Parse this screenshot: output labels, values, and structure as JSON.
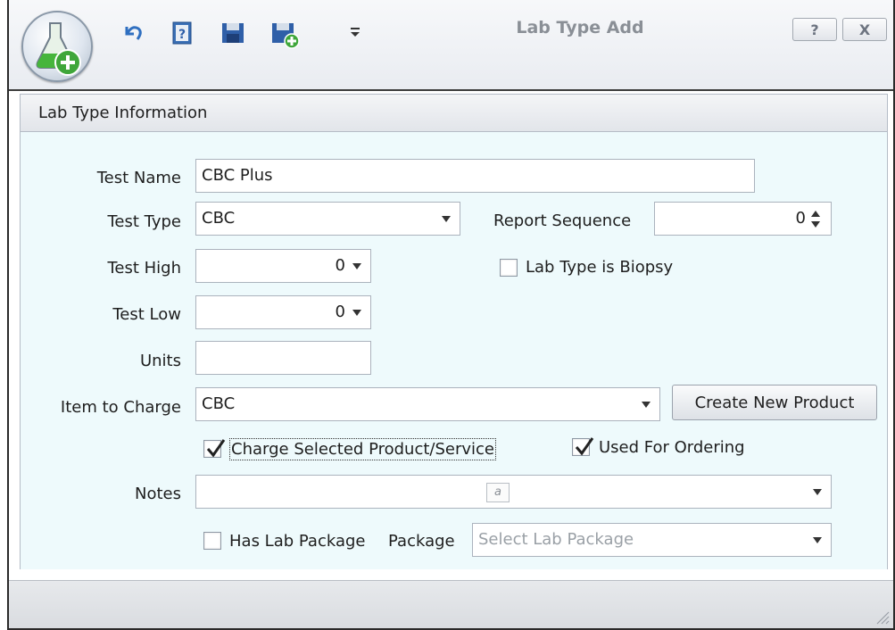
{
  "window": {
    "title": "Lab Type Add",
    "help_button": "?",
    "close_button": "X"
  },
  "quick_access": {
    "icons": [
      "undo-icon",
      "help-icon",
      "save-icon",
      "save-and-new-icon",
      "customize-dropdown-icon"
    ]
  },
  "group": {
    "header": "Lab Type Information"
  },
  "form": {
    "test_name": {
      "label": "Test Name",
      "value": "CBC Plus"
    },
    "test_type": {
      "label": "Test Type",
      "value": "CBC"
    },
    "report_sequence": {
      "label": "Report Sequence",
      "value": "0"
    },
    "test_high": {
      "label": "Test High",
      "value": "0"
    },
    "test_low": {
      "label": "Test Low",
      "value": "0"
    },
    "lab_type_is_biopsy": {
      "label": "Lab Type is Biopsy",
      "checked": false
    },
    "units": {
      "label": "Units",
      "value": ""
    },
    "item_to_charge": {
      "label": "Item to Charge",
      "value": "CBC"
    },
    "create_new_product": {
      "label": "Create New Product"
    },
    "charge_selected": {
      "label": "Charge Selected Product/Service",
      "checked": true
    },
    "used_for_ordering": {
      "label": "Used For Ordering",
      "checked": true
    },
    "notes": {
      "label": "Notes",
      "value": "",
      "editor_glyph": "a"
    },
    "has_lab_package": {
      "label": "Has Lab Package",
      "checked": false
    },
    "package": {
      "label": "Package",
      "placeholder": "Select Lab Package"
    }
  },
  "colors": {
    "group_body": "#eefafc",
    "accent_green": "#3fa63a",
    "ribbon_blue": "#2f5fa8"
  }
}
